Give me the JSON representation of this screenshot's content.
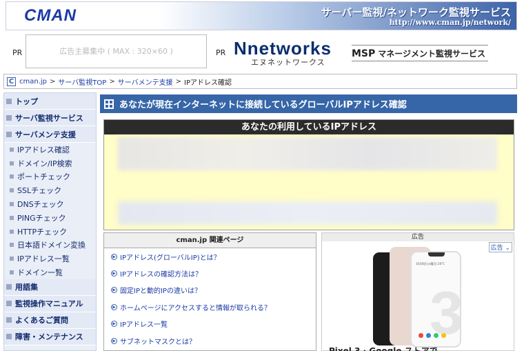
{
  "header": {
    "logo": "CMAN",
    "tagline": "サーバー監視/ネットワーク監視サービス",
    "url": "http://www.cman.jp/network/"
  },
  "pr": {
    "label1": "PR",
    "ad_placeholder": "広告主募集中 ( MAX : 320×60 )",
    "label2": "PR",
    "nnetworks": "Nnetworks",
    "nnetworks_sub": "エヌネットワークス",
    "msp_abbr": "MSP",
    "msp_text": "マネージメント監視サービス"
  },
  "breadcrumb": {
    "icon": "C",
    "items": [
      "cman.jp",
      "サーバ監視TOP",
      "サーバメンテ支援",
      "IPアドレス確認"
    ],
    "sep": ">"
  },
  "sidebar": {
    "top": "トップ",
    "server_monitor": "サーバ監視サービス",
    "maint": "サーバメンテ支援",
    "sub": [
      "IPアドレス確認",
      "ドメイン/IP検索",
      "ポートチェック",
      "SSLチェック",
      "DNSチェック",
      "PINGチェック",
      "HTTPチェック",
      "日本語ドメイン変換",
      "IPアドレス一覧",
      "ドメイン一覧"
    ],
    "glossary": "用語集",
    "manual": "監視操作マニュアル",
    "faq": "よくあるご質問",
    "trouble": "障害・メンテナンス"
  },
  "main": {
    "title": "あなたが現在インターネットに接続しているグローバルIPアドレス確認",
    "ip_heading": "あなたの利用しているIPアドレス"
  },
  "related": {
    "heading": "cman.jp 関連ページ",
    "links": [
      "IPアドレス(グローバルIP)とは？",
      "IPアドレスの確認方法は？",
      "固定IPと動的IPの違いは？",
      "ホームページにアクセスすると情報が取られる？",
      "IPアドレス一覧",
      "サブネットマスクとは？"
    ]
  },
  "ad": {
    "heading": "広告",
    "tag": "広告",
    "phone_time": "10月8日(火曜日) 20°C",
    "phone_digit": "3",
    "caption": "Pixel 3 · Google ストアで"
  }
}
